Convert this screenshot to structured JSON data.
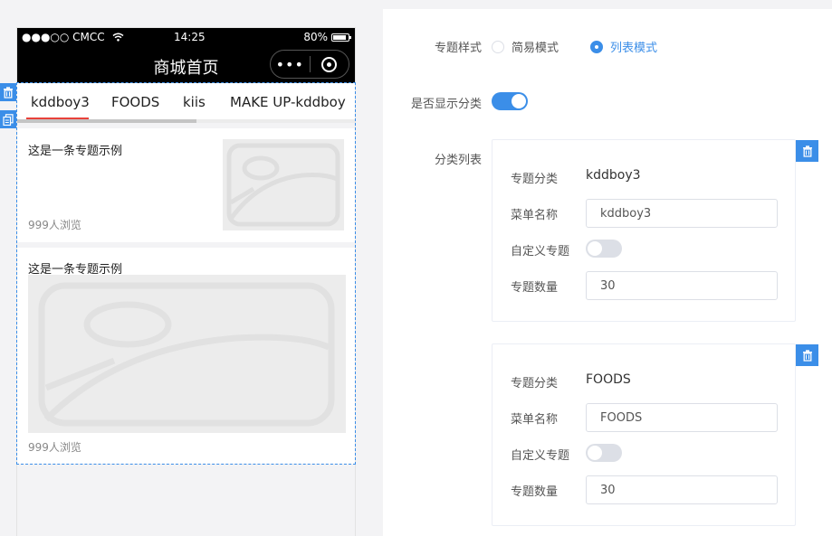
{
  "phone": {
    "status": {
      "carrier": "●●●○○ CMCC",
      "time": "14:25",
      "battery": "80%"
    },
    "nav_title": "商城首页",
    "capsule_dots": "•••",
    "tabs": [
      "kddboy3",
      "FOODS",
      "kiis",
      "MAKE UP-kddboy"
    ],
    "active_tab_index": 0,
    "articles": [
      {
        "title": "这是一条专题示例",
        "views": "999人浏览",
        "layout": "small-image"
      },
      {
        "title": "这是一条专题示例",
        "views": "999人浏览",
        "layout": "large-image"
      }
    ]
  },
  "form": {
    "style_label": "专题样式",
    "style_options": [
      "简易模式",
      "列表模式"
    ],
    "style_selected": "列表模式",
    "show_category_label": "是否显示分类",
    "show_category": true,
    "category_list_label": "分类列表",
    "categories": [
      {
        "category_label": "专题分类",
        "category_value": "kddboy3",
        "menu_label": "菜单名称",
        "menu_value": "kddboy3",
        "custom_label": "自定义专题",
        "custom_on": false,
        "count_label": "专题数量",
        "count_value": "30"
      },
      {
        "category_label": "专题分类",
        "category_value": "FOODS",
        "menu_label": "菜单名称",
        "menu_value": "FOODS",
        "custom_label": "自定义专题",
        "custom_on": false,
        "count_label": "专题数量",
        "count_value": "30"
      }
    ]
  },
  "colors": {
    "accent": "#3b8ee8",
    "tab_active_underline": "#e8413a",
    "nav_bg": "#000000"
  },
  "icons": [
    "wifi-icon",
    "battery-icon",
    "more-dots-icon",
    "close-circle-icon",
    "trash-icon",
    "copy-icon",
    "image-placeholder-icon"
  ]
}
